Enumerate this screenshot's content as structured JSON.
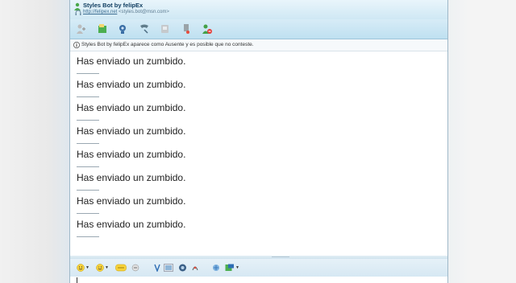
{
  "titlebar": {
    "name": "Styles Bot by felipEx",
    "link": "http://felipex.net",
    "email": "<styles.bot@msn.com>"
  },
  "toolbar": {
    "buttons": [
      {
        "name": "invite-contact-button",
        "icon": "invite-icon"
      },
      {
        "name": "send-files-button",
        "icon": "send-file-icon"
      },
      {
        "name": "video-call-button",
        "icon": "webcam-icon"
      },
      {
        "name": "voice-call-button",
        "icon": "phone-icon"
      },
      {
        "name": "activities-button",
        "icon": "activities-icon"
      },
      {
        "name": "games-button",
        "icon": "games-icon"
      },
      {
        "name": "block-contact-button",
        "icon": "block-icon"
      }
    ]
  },
  "infobar": {
    "text": "Styles Bot by felipEx aparece como Ausente y es posible que no conteste."
  },
  "chat": {
    "messages": [
      "Has enviado un zumbido.",
      "Has enviado un zumbido.",
      "Has enviado un zumbido.",
      "Has enviado un zumbido.",
      "Has enviado un zumbido.",
      "Has enviado un zumbido.",
      "Has enviado un zumbido.",
      "Has enviado un zumbido."
    ]
  },
  "format_bar": {
    "items": [
      "emoticon-icon",
      "wink-icon",
      "voice-clip-icon",
      "nudge-icon",
      "font-icon",
      "background-icon",
      "photo-icon",
      "handwriting-icon",
      "backgrounds-icon"
    ]
  },
  "colors": {
    "accent": "#3d6e92",
    "titlebar": "#cfe8f4",
    "toolbar": "#bfe0f0"
  }
}
